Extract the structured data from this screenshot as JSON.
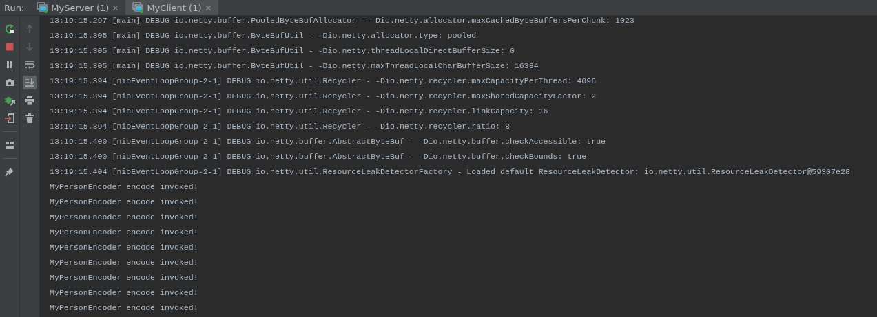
{
  "run_label": "Run:",
  "tabs": [
    {
      "label": "MyServer (1)",
      "selected": false
    },
    {
      "label": "MyClient (1)",
      "selected": true
    }
  ],
  "toolbar_primary": [
    {
      "kind": "rerun"
    },
    {
      "kind": "stop"
    },
    {
      "kind": "pause"
    },
    {
      "kind": "camera"
    },
    {
      "kind": "debug"
    },
    {
      "kind": "exit"
    },
    {
      "kind": "separator"
    },
    {
      "kind": "layout"
    },
    {
      "kind": "separator"
    },
    {
      "kind": "pin"
    }
  ],
  "toolbar_secondary": [
    {
      "kind": "up",
      "disabled": true,
      "selected": false
    },
    {
      "kind": "down",
      "disabled": true,
      "selected": false
    },
    {
      "kind": "wrap",
      "disabled": false,
      "selected": false
    },
    {
      "kind": "scroll_end",
      "disabled": false,
      "selected": true
    },
    {
      "kind": "print",
      "disabled": false,
      "selected": false
    },
    {
      "kind": "trash",
      "disabled": false,
      "selected": false
    }
  ],
  "console_lines": [
    "13:19:15.297 [main] DEBUG io.netty.buffer.PooledByteBufAllocator - -Dio.netty.allocator.maxCachedByteBuffersPerChunk: 1023",
    "13:19:15.305 [main] DEBUG io.netty.buffer.ByteBufUtil - -Dio.netty.allocator.type: pooled",
    "13:19:15.305 [main] DEBUG io.netty.buffer.ByteBufUtil - -Dio.netty.threadLocalDirectBufferSize: 0",
    "13:19:15.305 [main] DEBUG io.netty.buffer.ByteBufUtil - -Dio.netty.maxThreadLocalCharBufferSize: 16384",
    "13:19:15.394 [nioEventLoopGroup-2-1] DEBUG io.netty.util.Recycler - -Dio.netty.recycler.maxCapacityPerThread: 4096",
    "13:19:15.394 [nioEventLoopGroup-2-1] DEBUG io.netty.util.Recycler - -Dio.netty.recycler.maxSharedCapacityFactor: 2",
    "13:19:15.394 [nioEventLoopGroup-2-1] DEBUG io.netty.util.Recycler - -Dio.netty.recycler.linkCapacity: 16",
    "13:19:15.394 [nioEventLoopGroup-2-1] DEBUG io.netty.util.Recycler - -Dio.netty.recycler.ratio: 8",
    "13:19:15.400 [nioEventLoopGroup-2-1] DEBUG io.netty.buffer.AbstractByteBuf - -Dio.netty.buffer.checkAccessible: true",
    "13:19:15.400 [nioEventLoopGroup-2-1] DEBUG io.netty.buffer.AbstractByteBuf - -Dio.netty.buffer.checkBounds: true",
    "13:19:15.404 [nioEventLoopGroup-2-1] DEBUG io.netty.util.ResourceLeakDetectorFactory - Loaded default ResourceLeakDetector: io.netty.util.ResourceLeakDetector@59307e28",
    "MyPersonEncoder encode invoked!",
    "MyPersonEncoder encode invoked!",
    "MyPersonEncoder encode invoked!",
    "MyPersonEncoder encode invoked!",
    "MyPersonEncoder encode invoked!",
    "MyPersonEncoder encode invoked!",
    "MyPersonEncoder encode invoked!",
    "MyPersonEncoder encode invoked!",
    "MyPersonEncoder encode invoked!"
  ]
}
